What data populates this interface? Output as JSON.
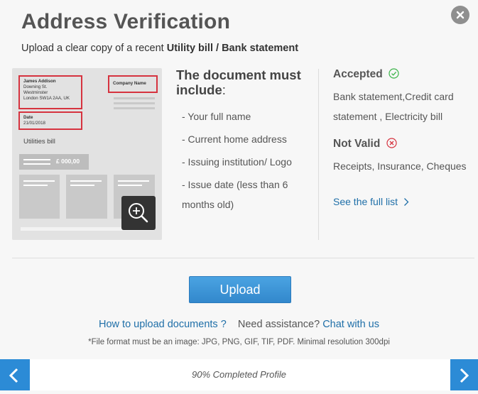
{
  "dialog": {
    "title": "Address Verification",
    "subtitle_prefix": "Upload a clear copy of a recent ",
    "subtitle_doc1": "Utility bill",
    "subtitle_sep": " / ",
    "subtitle_doc2": "Bank statement",
    "close_icon": "close-icon"
  },
  "sample_document": {
    "name": "James Addison",
    "address_line1": "Downing St.",
    "address_line2": "Westminster",
    "address_line3": "London SW1A 2AA, UK",
    "date_label": "Date",
    "date_value": "21/01/2018",
    "company_label": "Company Name",
    "doc_type": "Utilities bill",
    "amount": "£ 000,00",
    "zoom_icon": "zoom-in-icon"
  },
  "requirements": {
    "title": "The document must include",
    "title_colon": ":",
    "items": [
      "- Your full name",
      "- Current home address",
      "- Issuing institution/ Logo",
      "- Issue date (less than 6 months old)"
    ]
  },
  "accepted": {
    "title": "Accepted",
    "text": "Bank statement,Credit card statement , Electricity bill",
    "icon": "check-circle-icon",
    "icon_color": "#3cb44a"
  },
  "not_valid": {
    "title": "Not Valid",
    "text": "Receipts, Insurance, Cheques",
    "icon": "x-circle-icon",
    "icon_color": "#d6333f"
  },
  "full_list_link": "See the full list",
  "upload_button": "Upload",
  "help": {
    "how_to": "How to upload documents ?",
    "need_assistance": "Need assistance?",
    "chat": "Chat with us"
  },
  "format_note": "*File format must be an image: JPG, PNG, GIF, TIF, PDF. Minimal resolution 300dpi",
  "footer": {
    "progress_text": "90% Completed Profile",
    "progress_percent": 90,
    "prev_icon": "chevron-left-icon",
    "next_icon": "chevron-right-icon"
  }
}
